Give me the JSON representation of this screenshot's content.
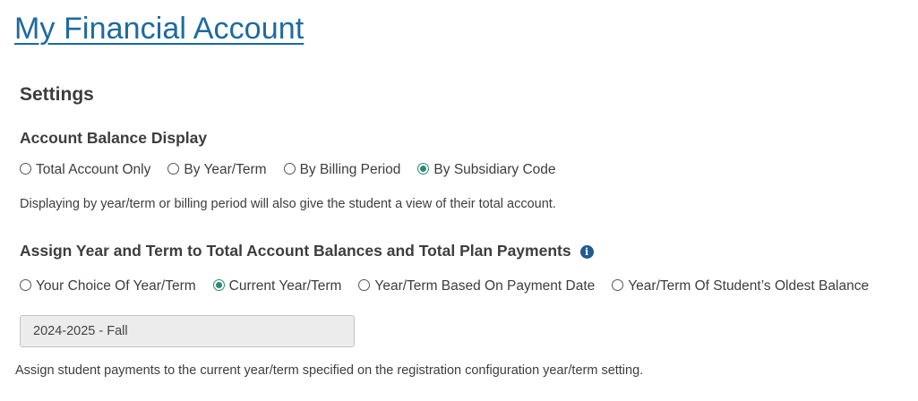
{
  "page": {
    "title": "My Financial Account"
  },
  "settings": {
    "heading": "Settings",
    "balance_display": {
      "heading": "Account Balance Display",
      "options": [
        {
          "label": "Total Account Only",
          "checked": false
        },
        {
          "label": "By Year/Term",
          "checked": false
        },
        {
          "label": "By Billing Period",
          "checked": false
        },
        {
          "label": "By Subsidiary Code",
          "checked": true
        }
      ],
      "help_text": "Displaying by year/term or billing period will also give the student a view of their total account."
    },
    "assign_term": {
      "heading": "Assign Year and Term to Total Account Balances and Total Plan Payments",
      "info_icon": "info-icon",
      "options": [
        {
          "label": "Your Choice Of Year/Term",
          "checked": false
        },
        {
          "label": "Current Year/Term",
          "checked": true
        },
        {
          "label": "Year/Term Based On Payment Date",
          "checked": false
        },
        {
          "label": "Year/Term Of Student’s Oldest Balance",
          "checked": false
        }
      ],
      "select_value": "2024-2025 - Fall",
      "help_text": "Assign student payments to the current year/term specified on the registration configuration year/term setting."
    }
  },
  "colors": {
    "link": "#1e6aa0",
    "radio_checked": "#2a8a73",
    "info_icon": "#1f5b91",
    "select_background": "#ececec"
  }
}
